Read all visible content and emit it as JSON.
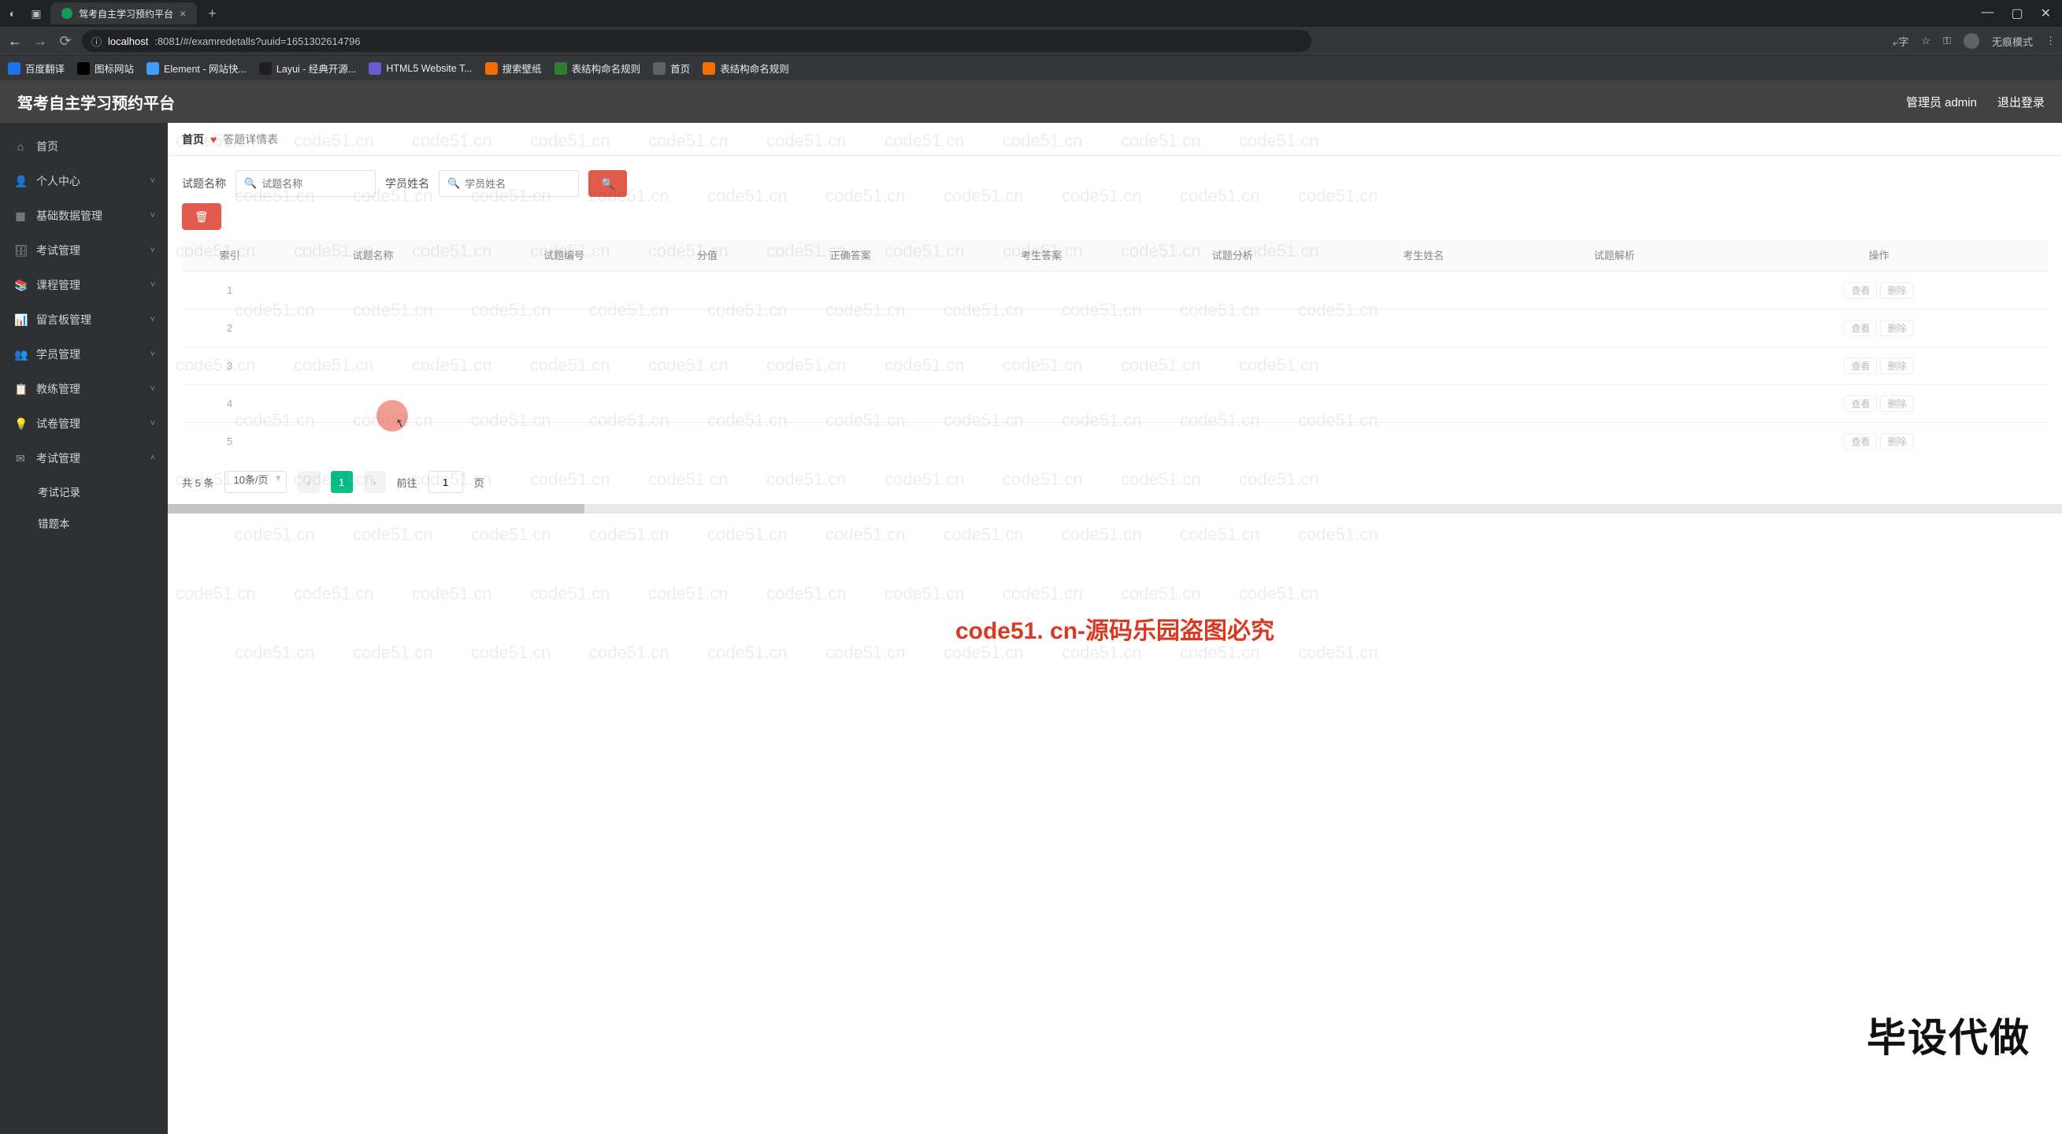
{
  "browser": {
    "tab_title": "驾考自主学习预约平台",
    "url_host": "localhost",
    "url_rest": ":8081/#/examredetalls?uuid=1651302614796",
    "incognito_label": "无痕模式",
    "bookmarks": [
      {
        "label": "百度翻译",
        "fav": "blue"
      },
      {
        "label": "图标网站",
        "fav": "flag"
      },
      {
        "label": "Element - 网站快...",
        "fav": "cyan"
      },
      {
        "label": "Layui - 经典开源...",
        "fav": "dark"
      },
      {
        "label": "HTML5 Website T...",
        "fav": "purp"
      },
      {
        "label": "搜索壁纸",
        "fav": "orange"
      },
      {
        "label": "表结构命名规则",
        "fav": "green"
      },
      {
        "label": "首页",
        "fav": "grey"
      },
      {
        "label": "表结构命名规则",
        "fav": "orange"
      }
    ]
  },
  "app": {
    "title": "驾考自主学习预约平台",
    "user_label": "管理员 admin",
    "logout_label": "退出登录"
  },
  "sidebar": [
    {
      "icon": "⌂",
      "label": "首页",
      "type": "item"
    },
    {
      "icon": "👤",
      "label": "个人中心",
      "type": "group"
    },
    {
      "icon": "▦",
      "label": "基础数据管理",
      "type": "group"
    },
    {
      "icon": "🗄",
      "label": "考试管理",
      "type": "group"
    },
    {
      "icon": "📚",
      "label": "课程管理",
      "type": "group"
    },
    {
      "icon": "📊",
      "label": "留言板管理",
      "type": "group"
    },
    {
      "icon": "👥",
      "label": "学员管理",
      "type": "group"
    },
    {
      "icon": "📋",
      "label": "教练管理",
      "type": "group"
    },
    {
      "icon": "💡",
      "label": "试卷管理",
      "type": "group"
    },
    {
      "icon": "✉",
      "label": "考试管理",
      "type": "group",
      "open": true,
      "subs": [
        "考试记录",
        "错题本"
      ]
    }
  ],
  "crumbs": {
    "home": "首页",
    "current": "答题详情表"
  },
  "filters": {
    "q1_label": "试题名称",
    "q1_placeholder": "试题名称",
    "q2_label": "学员姓名",
    "q2_placeholder": "学员姓名"
  },
  "table": {
    "headers": [
      "索引",
      "试题名称",
      "试题编号",
      "分值",
      "正确答案",
      "考生答案",
      "试题分析",
      "考生姓名",
      "试题解析",
      "操作"
    ],
    "rows": [
      [
        "1",
        "",
        "",
        "",
        "",
        "",
        "",
        "",
        "",
        "查看 删除"
      ],
      [
        "2",
        "",
        "",
        "",
        "",
        "",
        "",
        "",
        "",
        "查看 删除"
      ],
      [
        "3",
        "",
        "",
        "",
        "",
        "",
        "",
        "",
        "",
        "查看 删除"
      ],
      [
        "4",
        "",
        "",
        "",
        "",
        "",
        "",
        "",
        "",
        "查看 删除"
      ],
      [
        "5",
        "",
        "",
        "",
        "",
        "",
        "",
        "",
        "",
        "查看 删除"
      ]
    ]
  },
  "pager": {
    "total_text": "共 5 条",
    "size_text": "10条/页",
    "current": "1",
    "jump_prefix": "前往",
    "jump_value": "1",
    "jump_suffix": "页"
  },
  "wm": {
    "text": "code51.cn",
    "main": "code51. cn-源码乐园盗图必究",
    "brand": "毕设代做"
  }
}
